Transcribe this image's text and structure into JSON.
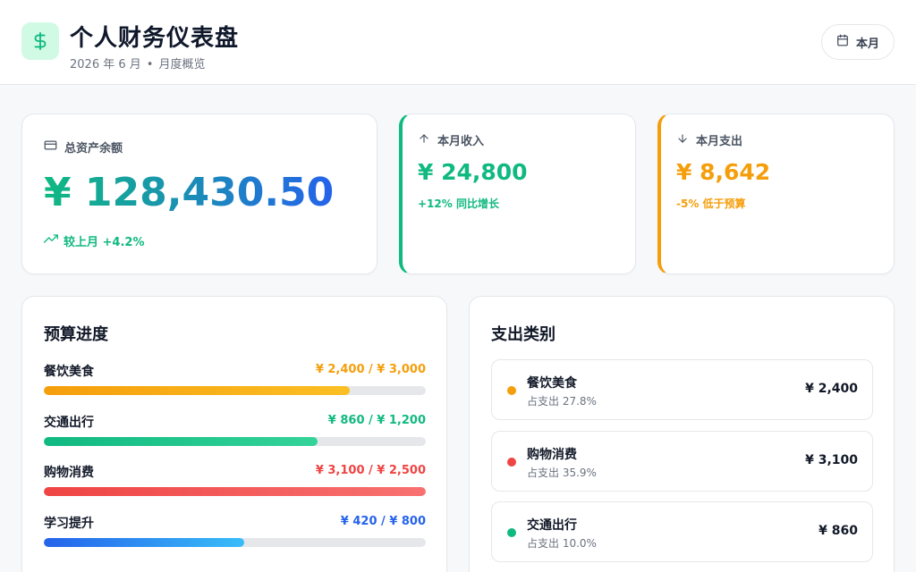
{
  "header": {
    "title": "个人财务仪表盘",
    "period": "2026 年 6 月",
    "separator": "•",
    "view": "月度概览",
    "month_button": "本月"
  },
  "summary": {
    "total": {
      "label": "总资产余额",
      "value": "¥ 128,430.50",
      "change": "较上月 +4.2%"
    },
    "income": {
      "label": "本月收入",
      "value": "¥ 24,800",
      "note": "+12% 同比增长"
    },
    "expense": {
      "label": "本月支出",
      "value": "¥ 8,642",
      "note": "-5% 低于预算"
    }
  },
  "budget": {
    "title": "预算进度",
    "items": [
      {
        "name": "餐饮美食",
        "amount": "¥ 2,400 / ¥ 3,000",
        "progress": 0.8,
        "color": "#f59e0b",
        "color_end": "#fbbf24"
      },
      {
        "name": "交通出行",
        "amount": "¥ 860 / ¥ 1,200",
        "progress": 0.717,
        "color": "#10b981",
        "color_end": "#34d399"
      },
      {
        "name": "购物消费",
        "amount": "¥ 3,100 / ¥ 2,500",
        "progress": 1.0,
        "color": "#ef4444",
        "color_end": "#f87171"
      },
      {
        "name": "学习提升",
        "amount": "¥ 420 / ¥ 800",
        "progress": 0.525,
        "color": "#2563eb",
        "color_end": "#38bdf8"
      }
    ]
  },
  "categories": {
    "title": "支出类别",
    "items": [
      {
        "name": "餐饮美食",
        "share": "占支出 27.8%",
        "amount": "¥ 2,400",
        "color": "#f59e0b"
      },
      {
        "name": "购物消费",
        "share": "占支出 35.9%",
        "amount": "¥ 3,100",
        "color": "#ef4444"
      },
      {
        "name": "交通出行",
        "share": "占支出 10.0%",
        "amount": "¥ 860",
        "color": "#10b981"
      }
    ]
  },
  "colors": {
    "accent": "#10b981",
    "income": "#10b981",
    "expense": "#f59e0b",
    "budget_amounts": [
      "#f59e0b",
      "#10b981",
      "#ef4444",
      "#2563eb"
    ]
  },
  "icons": {
    "logo": "dollar-sign-icon",
    "month_button": "calendar-icon",
    "total": "credit-card-icon",
    "change": "trending-up-icon",
    "income": "arrow-up-icon",
    "expense": "arrow-down-icon"
  }
}
